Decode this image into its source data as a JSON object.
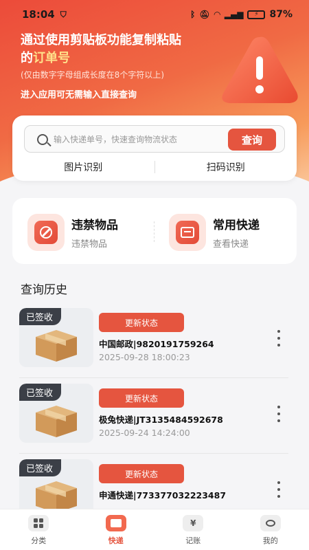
{
  "status_bar": {
    "time": "18:04",
    "battery": "87%"
  },
  "hero": {
    "title_line1": "通过使用剪贴板功能复制粘贴",
    "title_prefix": "的",
    "title_highlight": "订单号",
    "subtitle": "(仅由数字字母组成长度在8个字符以上)",
    "subtitle2": "进入应用可无需输入直接查询"
  },
  "search": {
    "placeholder": "输入快递单号，快速查询物流状态",
    "button_label": "查询",
    "image_recognition": "图片识别",
    "scan_recognition": "扫码识别"
  },
  "categories": [
    {
      "title": "违禁物品",
      "subtitle": "违禁物品",
      "icon": "prohibited-icon"
    },
    {
      "title": "常用快递",
      "subtitle": "查看快递",
      "icon": "express-doc-icon"
    }
  ],
  "history": {
    "title": "查询历史",
    "items": [
      {
        "badge": "已签收",
        "button": "更新状态",
        "tracking": "中国邮政|9820191759264",
        "time": "2025-09-28 18:00:23"
      },
      {
        "badge": "已签收",
        "button": "更新状态",
        "tracking": "极兔快递|JT3135484592678",
        "time": "2025-09-24 14:24:00"
      },
      {
        "badge": "已签收",
        "button": "更新状态",
        "tracking": "申通快递|773377032223487",
        "time": ""
      }
    ]
  },
  "tabbar": {
    "items": [
      {
        "label": "分类",
        "active": false
      },
      {
        "label": "快递",
        "active": true
      },
      {
        "label": "记账",
        "active": false
      },
      {
        "label": "我的",
        "active": false
      }
    ]
  },
  "colors": {
    "accent": "#e5553f",
    "badge_bg": "#3b3f47",
    "highlight": "#ffe08a"
  }
}
